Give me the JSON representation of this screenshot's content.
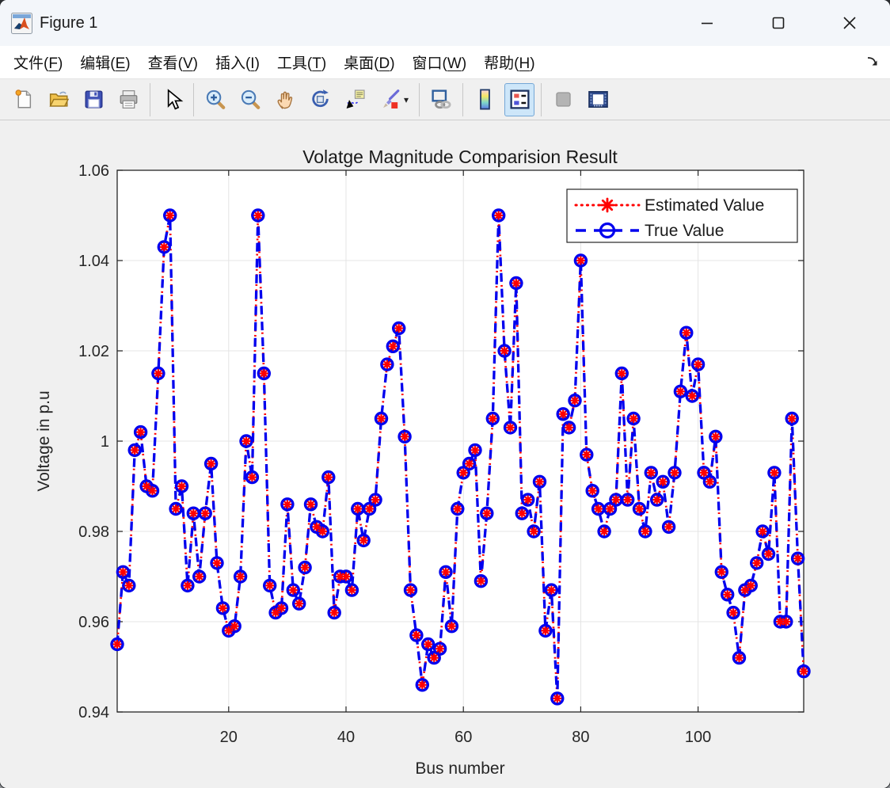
{
  "window": {
    "title": "Figure 1"
  },
  "menu": {
    "items": [
      {
        "slug": "file",
        "pre": "文件(",
        "key": "F",
        "post": ")"
      },
      {
        "slug": "edit",
        "pre": "编辑(",
        "key": "E",
        "post": ")"
      },
      {
        "slug": "view",
        "pre": "查看(",
        "key": "V",
        "post": ")"
      },
      {
        "slug": "insert",
        "pre": "插入(",
        "key": "I",
        "post": ")"
      },
      {
        "slug": "tools",
        "pre": "工具(",
        "key": "T",
        "post": ")"
      },
      {
        "slug": "desktop",
        "pre": "桌面(",
        "key": "D",
        "post": ")"
      },
      {
        "slug": "window",
        "pre": "窗口(",
        "key": "W",
        "post": ")"
      },
      {
        "slug": "help",
        "pre": "帮助(",
        "key": "H",
        "post": ")"
      }
    ]
  },
  "toolbar": {
    "groups": [
      {
        "items": [
          {
            "name": "new-figure"
          },
          {
            "name": "open-file"
          },
          {
            "name": "save-figure"
          },
          {
            "name": "print-figure"
          }
        ]
      },
      {
        "items": [
          {
            "name": "edit-plot"
          }
        ]
      },
      {
        "items": [
          {
            "name": "zoom-in"
          },
          {
            "name": "zoom-out"
          },
          {
            "name": "pan"
          },
          {
            "name": "rotate-3d"
          },
          {
            "name": "data-cursor"
          },
          {
            "name": "brush-data",
            "has_dropdown": true
          }
        ]
      },
      {
        "items": [
          {
            "name": "link-plot"
          }
        ]
      },
      {
        "items": [
          {
            "name": "insert-colorbar"
          },
          {
            "name": "insert-legend",
            "active": true
          }
        ]
      },
      {
        "items": [
          {
            "name": "hide-plot-tools",
            "enabled": false
          },
          {
            "name": "show-plot-tools"
          }
        ]
      }
    ]
  },
  "colors": {
    "estimated_series": "#FF0000",
    "true_series": "#0000EE",
    "figure_background": "#F0F0F0",
    "plot_background": "#FFFFFF",
    "grid": "#E4E4E4",
    "axes": "#262626",
    "active_tool_background": "#CDE6F9"
  },
  "chart_data": {
    "type": "line",
    "title": "Volatge Magnitude Comparision Result",
    "xlabel": "Bus number",
    "ylabel": "Voltage in p.u",
    "xlim": [
      1,
      118
    ],
    "ylim": [
      0.94,
      1.06
    ],
    "x_ticks": [
      20,
      40,
      60,
      80,
      100
    ],
    "x_tick_labels": [
      "20",
      "40",
      "60",
      "80",
      "100"
    ],
    "y_ticks": [
      0.94,
      0.96,
      0.98,
      1,
      1.02,
      1.04,
      1.06
    ],
    "y_tick_labels": [
      "0.94",
      "0.96",
      "0.98",
      "1",
      "1.02",
      "1.04",
      "1.06"
    ],
    "grid": true,
    "n_points": 118,
    "legend": {
      "position": "northeast",
      "entries": [
        "Estimated Value",
        "True Value"
      ]
    },
    "series": [
      {
        "name": "Estimated Value",
        "color": "#FF0000",
        "line_style": "dotted",
        "marker": "asterisk",
        "values": [
          0.955,
          0.971,
          0.968,
          0.998,
          1.002,
          0.99,
          0.989,
          1.015,
          1.043,
          1.05,
          0.985,
          0.99,
          0.968,
          0.984,
          0.97,
          0.984,
          0.995,
          0.973,
          0.963,
          0.958,
          0.959,
          0.97,
          1.0,
          0.992,
          1.05,
          1.015,
          0.968,
          0.962,
          0.963,
          0.986,
          0.967,
          0.964,
          0.972,
          0.986,
          0.981,
          0.98,
          0.992,
          0.962,
          0.97,
          0.97,
          0.967,
          0.985,
          0.978,
          0.985,
          0.987,
          1.005,
          1.017,
          1.021,
          1.025,
          1.001,
          0.967,
          0.957,
          0.946,
          0.955,
          0.952,
          0.954,
          0.971,
          0.959,
          0.985,
          0.993,
          0.995,
          0.998,
          0.969,
          0.984,
          1.005,
          1.05,
          1.02,
          1.003,
          1.035,
          0.984,
          0.987,
          0.98,
          0.991,
          0.958,
          0.967,
          0.943,
          1.006,
          1.003,
          1.009,
          1.04,
          0.997,
          0.989,
          0.985,
          0.98,
          0.985,
          0.987,
          1.015,
          0.987,
          1.005,
          0.985,
          0.98,
          0.993,
          0.987,
          0.991,
          0.981,
          0.993,
          1.011,
          1.024,
          1.01,
          1.017,
          0.993,
          0.991,
          1.001,
          0.971,
          0.966,
          0.962,
          0.952,
          0.967,
          0.968,
          0.973,
          0.98,
          0.975,
          0.993,
          0.96,
          0.96,
          1.005,
          0.974,
          0.949
        ]
      },
      {
        "name": "True Value",
        "color": "#0000EE",
        "line_style": "dashed",
        "marker": "open-circle",
        "values": [
          0.955,
          0.971,
          0.968,
          0.998,
          1.002,
          0.99,
          0.989,
          1.015,
          1.043,
          1.05,
          0.985,
          0.99,
          0.968,
          0.984,
          0.97,
          0.984,
          0.995,
          0.973,
          0.963,
          0.958,
          0.959,
          0.97,
          1.0,
          0.992,
          1.05,
          1.015,
          0.968,
          0.962,
          0.963,
          0.986,
          0.967,
          0.964,
          0.972,
          0.986,
          0.981,
          0.98,
          0.992,
          0.962,
          0.97,
          0.97,
          0.967,
          0.985,
          0.978,
          0.985,
          0.987,
          1.005,
          1.017,
          1.021,
          1.025,
          1.001,
          0.967,
          0.957,
          0.946,
          0.955,
          0.952,
          0.954,
          0.971,
          0.959,
          0.985,
          0.993,
          0.995,
          0.998,
          0.969,
          0.984,
          1.005,
          1.05,
          1.02,
          1.003,
          1.035,
          0.984,
          0.987,
          0.98,
          0.991,
          0.958,
          0.967,
          0.943,
          1.006,
          1.003,
          1.009,
          1.04,
          0.997,
          0.989,
          0.985,
          0.98,
          0.985,
          0.987,
          1.015,
          0.987,
          1.005,
          0.985,
          0.98,
          0.993,
          0.987,
          0.991,
          0.981,
          0.993,
          1.011,
          1.024,
          1.01,
          1.017,
          0.993,
          0.991,
          1.001,
          0.971,
          0.966,
          0.962,
          0.952,
          0.967,
          0.968,
          0.973,
          0.98,
          0.975,
          0.993,
          0.96,
          0.96,
          1.005,
          0.974,
          0.949
        ]
      }
    ]
  }
}
